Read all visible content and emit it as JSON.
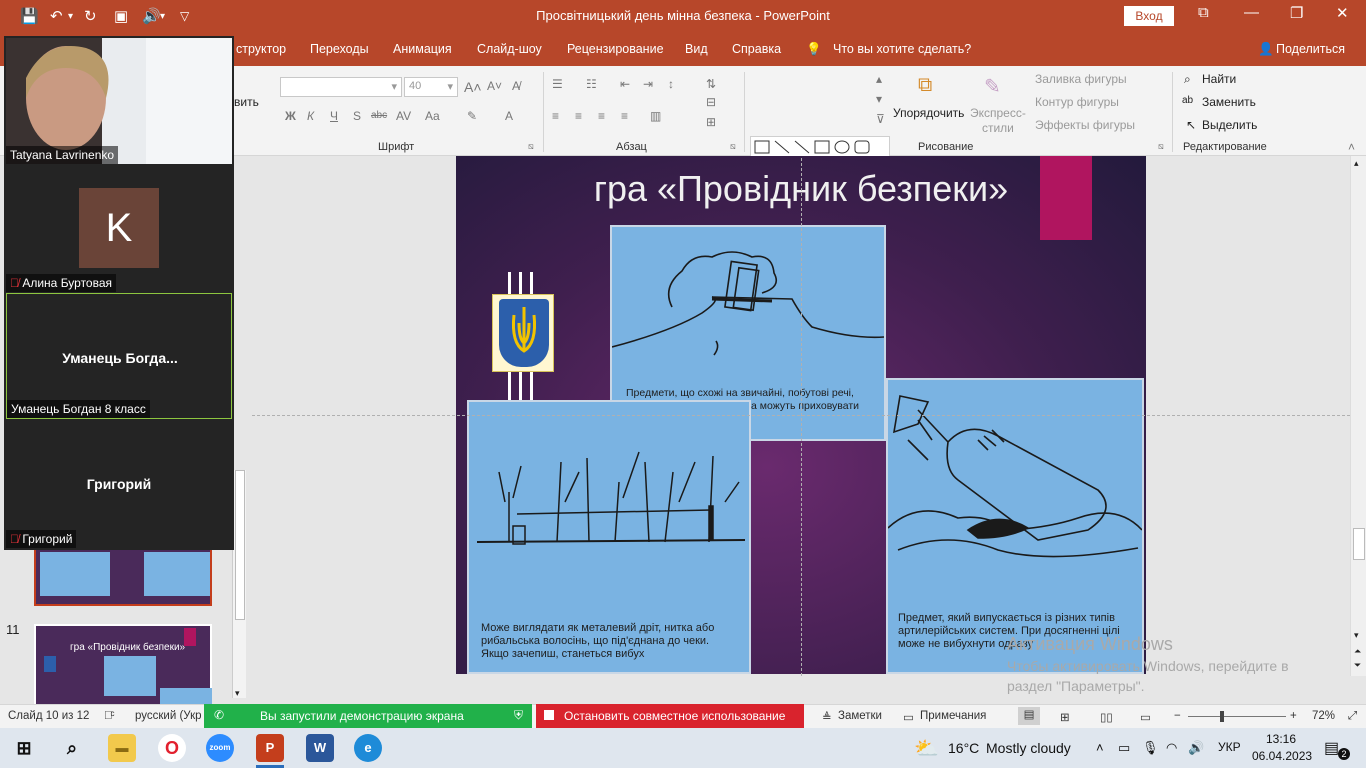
{
  "window": {
    "title": "Просвітницький день мінна безпека  -  PowerPoint",
    "signin": "Вход"
  },
  "quick_access": {
    "save_icon": "save-icon",
    "undo_icon": "undo-icon",
    "redo_icon": "redo-icon",
    "present_icon": "present-icon",
    "audio_icon": "speaker-icon"
  },
  "menu": {
    "tabs": [
      "структор",
      "Переходы",
      "Анимация",
      "Слайд-шоу",
      "Рецензирование",
      "Вид",
      "Справка"
    ],
    "tellme": "Что вы хотите сделать?",
    "share": "Поделиться"
  },
  "ribbon": {
    "clipboard_partial": "вить",
    "font_group": "Шрифт",
    "font_size": "40",
    "bold": "Ж",
    "italic": "К",
    "underline": "Ч",
    "strike": "S",
    "strike2": "abc",
    "spacing": "AV",
    "case": "Aa",
    "paragraph_group": "Абзац",
    "drawing_group": "Рисование",
    "arrange": "Упорядочить",
    "quick_styles": "Экспресс-\nстили",
    "fill": "Заливка фигуры",
    "outline": "Контур фигуры",
    "effects": "Эффекты фигуры",
    "edit_group": "Редактирование",
    "find": "Найти",
    "replace": "Заменить",
    "select": "Выделить"
  },
  "slide": {
    "title": "гра «Провідник безпеки»",
    "card_top_text": "Предмети, що схожі на звичайні, побутові речі, які викликають недовіру та можуть приховувати небезпеку",
    "card_left_text": "Може виглядати як металевий дріт, нитка або рибальська волосінь, що під'єднана до чеки. Якщо зачепиш, станеться вибух",
    "card_right_text": "Предмет, який випускається із різних типів артилерійських систем. При досягненні цілі може не вибухнути одразу"
  },
  "watermark": {
    "line1": "Активация Windows",
    "line2": "Чтобы активировать Windows, перейдите в",
    "line3": "раздел \"Параметры\"."
  },
  "thumbnails": {
    "slide11_num": "11",
    "slide11_title": "гра «Провідник безпеки»"
  },
  "zoom": {
    "tiles": [
      {
        "name": "Tatyana Lavrinenko"
      },
      {
        "name": "Алина Буртовая",
        "initial": "K"
      },
      {
        "big": "Уманець  Богда...",
        "name": "Уманець Богдан 8 класс"
      },
      {
        "big": "Григорий",
        "name": "Григорий"
      }
    ]
  },
  "status": {
    "slide_info": "Слайд 10 из 12",
    "language": "русский (Укр",
    "sharing": "Вы запустили демонстрацию экрана",
    "stop_sharing": "Остановить совместное использование",
    "notes": "Заметки",
    "comments": "Примечания",
    "zoom_level": "72%"
  },
  "taskbar": {
    "weather_temp": "16°C",
    "weather_desc": "Mostly cloudy",
    "lang": "УКР",
    "time": "13:16",
    "date": "06.04.2023",
    "notif_count": "2"
  },
  "colors": {
    "accent": "#b7472a",
    "slide_bg": "#3f1f4e",
    "card": "#7ab3e2",
    "pink": "#b0155f",
    "share_green": "#21b14a",
    "stop_red": "#d9232d"
  }
}
